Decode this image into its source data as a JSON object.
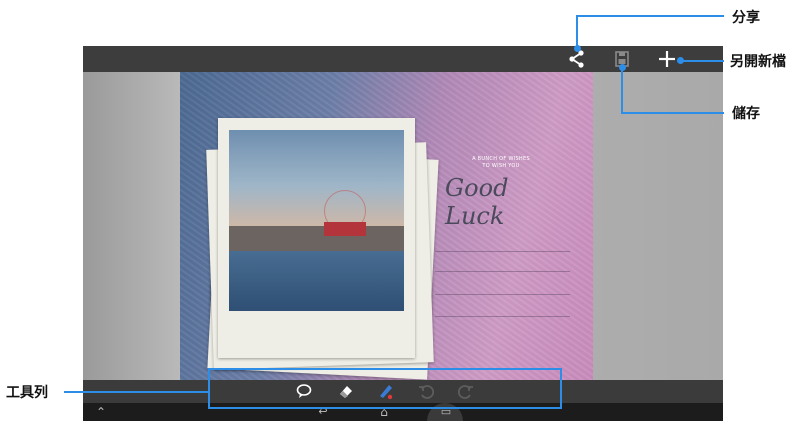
{
  "toolbar_top": {
    "share_icon": "share-icon",
    "save_icon": "save-icon",
    "new_icon": "plus-icon"
  },
  "card": {
    "wish_line1": "A BUNCH OF WISHES",
    "wish_line2": "TO WISH YOU",
    "greeting": "Good Luck"
  },
  "tools": [
    {
      "icon": "speech-bubble-icon",
      "glyph": "💬"
    },
    {
      "icon": "eraser-icon",
      "glyph": "◆"
    },
    {
      "icon": "pen-icon",
      "glyph": "✎"
    },
    {
      "icon": "undo-icon",
      "glyph": "↶"
    },
    {
      "icon": "redo-icon",
      "glyph": "↷"
    }
  ],
  "nav": {
    "up_glyph": "⌃",
    "back_glyph": "↩",
    "home_glyph": "⌂",
    "recent_glyph": "▭"
  },
  "callouts": {
    "share": "分享",
    "save_as_new": "另開新檔",
    "save": "儲存",
    "toolbar": "工具列"
  },
  "colors": {
    "accent": "#2d8ee8",
    "pen_red": "#e0393b",
    "pen_blue": "#3a7bd5"
  }
}
